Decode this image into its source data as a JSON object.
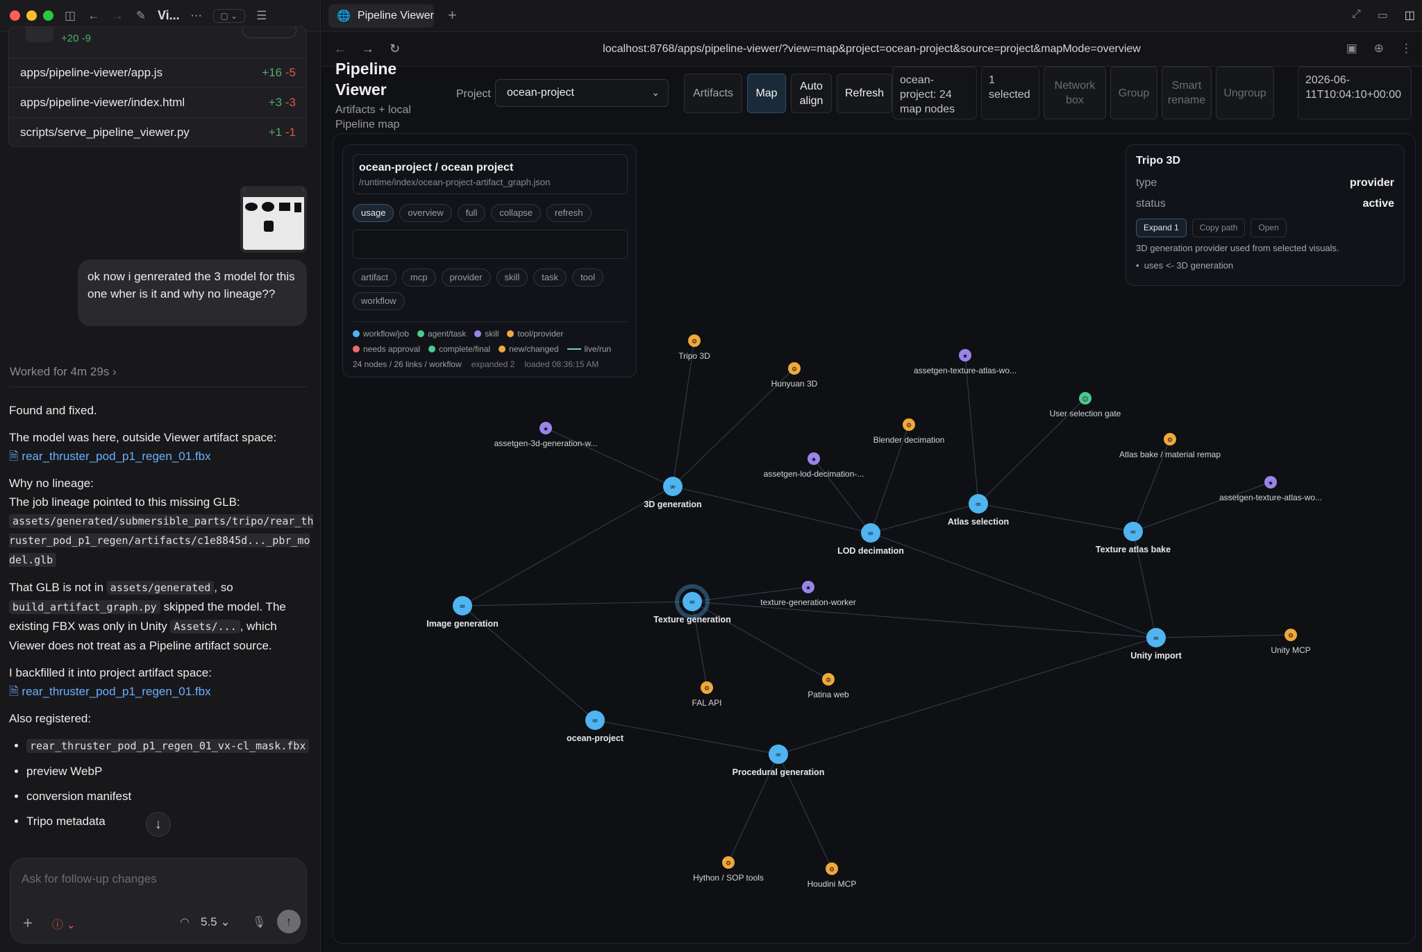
{
  "left": {
    "window": {
      "title": "Vi...",
      "icons": [
        "sidebar-icon",
        "back-icon",
        "forward-icon",
        "compose-icon",
        "more-icon",
        "layout-icon",
        "list-icon"
      ]
    },
    "file_card": {
      "summary": "+20 -9",
      "files": [
        {
          "path": "apps/pipeline-viewer/app.js",
          "plus": "+16",
          "minus": "-5"
        },
        {
          "path": "apps/pipeline-viewer/index.html",
          "plus": "+3",
          "minus": "-3"
        },
        {
          "path": "scripts/serve_pipeline_viewer.py",
          "plus": "+1",
          "minus": "-1"
        }
      ]
    },
    "user_message": "ok now i genrerated the 3 model for this one wher is it and why no lineage??",
    "worked": "Worked for 4m 29s",
    "chat": {
      "p1": "Found and fixed.",
      "p2": "The model was here, outside Viewer artifact space:",
      "link1": "rear_thruster_pod_p1_regen_01.fbx",
      "p3a": "Why no lineage:",
      "p3b": "The job lineage pointed to this missing GLB:",
      "code1": "assets/generated/submersible_parts/tripo/rear_thruster_pod_p1_regen/artifacts/c1e8845d..._pbr_model.glb",
      "p4a": "That GLB is not in ",
      "code2": "assets/generated",
      "p4b": ", so ",
      "code3": "build_artifact_graph.py",
      "p4c": " skipped the model. The existing FBX was only in Unity ",
      "code4": "Assets/...",
      "p4d": ", which Viewer does not treat as a Pipeline artifact source.",
      "p5": "I backfilled it into project artifact space:",
      "link2": "rear_thruster_pod_p1_regen_01.fbx",
      "p6": "Also registered:",
      "list_code": "rear_thruster_pod_p1_regen_01_vx-cl_mask.fbx",
      "list2": "preview WebP",
      "list3": "conversion manifest",
      "list4": "Tripo metadata"
    },
    "composer": {
      "placeholder": "Ask for follow-up changes",
      "model": "5.5"
    }
  },
  "browser": {
    "tab_title": "Pipeline Viewer",
    "url": "localhost:8768/apps/pipeline-viewer/?view=map&project=ocean-project&source=project&mapMode=overview"
  },
  "app": {
    "title": "Pipeline Viewer",
    "subtitle": "Artifacts + local Pipeline map",
    "project_label": "Project",
    "project_value": "ocean-project",
    "buttons": {
      "artifacts": "Artifacts",
      "map": "Map",
      "auto_align": "Auto align",
      "refresh": "Refresh",
      "network_box": "Network box",
      "group": "Group",
      "smart_rename": "Smart rename",
      "ungroup": "Ungroup"
    },
    "stats": {
      "nodes": "ocean-project: 24 map nodes",
      "selected": "1 selected",
      "timestamp": "2026-06-11T10:04:10+00:00"
    }
  },
  "panel": {
    "title": "ocean-project / ocean project",
    "path": "/runtime/index/ocean-project-artifact_graph.json",
    "modes": [
      "usage",
      "overview",
      "full",
      "collapse",
      "refresh"
    ],
    "filters": [
      "artifact",
      "mcp",
      "provider",
      "skill",
      "task",
      "tool",
      "workflow"
    ],
    "legend": [
      {
        "label": "workflow/job",
        "color": "#4fb4f0"
      },
      {
        "label": "agent/task",
        "color": "#4cc990"
      },
      {
        "label": "skill",
        "color": "#9a84e8"
      },
      {
        "label": "tool/provider",
        "color": "#f0a83c"
      },
      {
        "label": "needs approval",
        "color": "#ef6a6a"
      },
      {
        "label": "complete/final",
        "color": "#4cc990"
      },
      {
        "label": "new/changed",
        "color": "#f0a83c"
      }
    ],
    "legend_line": "live/run",
    "footer": {
      "counts": "24 nodes / 26 links / workflow",
      "expanded": "expanded 2",
      "loaded": "loaded 08:36:15 AM"
    }
  },
  "detail": {
    "title": "Tripo 3D",
    "type_label": "type",
    "type_value": "provider",
    "status_label": "status",
    "status_value": "active",
    "buttons": [
      "Expand 1",
      "Copy path",
      "Open"
    ],
    "description": "3D generation provider used from selected visuals.",
    "uses": "uses <- 3D generation"
  },
  "graph": {
    "nodes": [
      {
        "id": "tripo",
        "label": "Tripo 3D",
        "kind": "provider",
        "main": false
      },
      {
        "id": "hunyuan",
        "label": "Hunyuan 3D",
        "kind": "provider",
        "main": false
      },
      {
        "id": "atlaswo1",
        "label": "assetgen-texture-atlas-wo...",
        "kind": "skill",
        "main": false
      },
      {
        "id": "usergate",
        "label": "User selection gate",
        "kind": "agent",
        "main": false
      },
      {
        "id": "blender",
        "label": "Blender decimation",
        "kind": "provider",
        "main": false
      },
      {
        "id": "atlasbake",
        "label": "Atlas bake / material remap",
        "kind": "provider",
        "main": false
      },
      {
        "id": "gen3dw",
        "label": "assetgen-3d-generation-w...",
        "kind": "skill",
        "main": false
      },
      {
        "id": "lodw",
        "label": "assetgen-lod-decimation-...",
        "kind": "skill",
        "main": false
      },
      {
        "id": "atlaswo2",
        "label": "assetgen-texture-atlas-wo...",
        "kind": "skill",
        "main": false
      },
      {
        "id": "gen3d",
        "label": "3D generation",
        "kind": "workflow",
        "main": true
      },
      {
        "id": "atlassel",
        "label": "Atlas selection",
        "kind": "workflow",
        "main": true
      },
      {
        "id": "lod",
        "label": "LOD decimation",
        "kind": "workflow",
        "main": true
      },
      {
        "id": "texbake",
        "label": "Texture atlas bake",
        "kind": "workflow",
        "main": true
      },
      {
        "id": "texw",
        "label": "texture-generation-worker",
        "kind": "skill",
        "main": false
      },
      {
        "id": "imggen",
        "label": "Image generation",
        "kind": "workflow",
        "main": true
      },
      {
        "id": "texgen",
        "label": "Texture generation",
        "kind": "workflow",
        "main": true
      },
      {
        "id": "unityimp",
        "label": "Unity import",
        "kind": "workflow",
        "main": true
      },
      {
        "id": "unitymcp",
        "label": "Unity MCP",
        "kind": "provider",
        "main": false
      },
      {
        "id": "falapi",
        "label": "FAL API",
        "kind": "provider",
        "main": false
      },
      {
        "id": "patina",
        "label": "Patina web",
        "kind": "provider",
        "main": false
      },
      {
        "id": "ocean",
        "label": "ocean-project",
        "kind": "workflow",
        "main": true
      },
      {
        "id": "procgen",
        "label": "Procedural generation",
        "kind": "workflow",
        "main": true
      },
      {
        "id": "hython",
        "label": "Hython / SOP tools",
        "kind": "provider",
        "main": false
      },
      {
        "id": "houdini",
        "label": "Houdini MCP",
        "kind": "provider",
        "main": false
      }
    ],
    "colors": {
      "workflow": "#4fb4f0",
      "skill": "#9a84e8",
      "provider": "#f0a83c",
      "agent": "#4cc990"
    }
  }
}
